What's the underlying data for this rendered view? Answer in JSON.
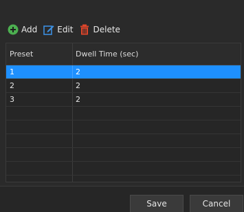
{
  "toolbar": {
    "add_label": "Add",
    "edit_label": "Edit",
    "delete_label": "Delete",
    "add_icon": "plus-circle-icon",
    "edit_icon": "edit-icon",
    "delete_icon": "trash-icon",
    "add_color": "#4caf50",
    "edit_color": "#3d8fe0",
    "delete_color": "#e0452a"
  },
  "table": {
    "columns": [
      "Preset",
      "Dwell Time (sec)"
    ],
    "rows": [
      {
        "preset": "1",
        "dwell": "2",
        "selected": true
      },
      {
        "preset": "2",
        "dwell": "2",
        "selected": false
      },
      {
        "preset": "3",
        "dwell": "2",
        "selected": false
      }
    ],
    "selection_color": "#1e90ff"
  },
  "footer": {
    "save_label": "Save",
    "cancel_label": "Cancel"
  }
}
